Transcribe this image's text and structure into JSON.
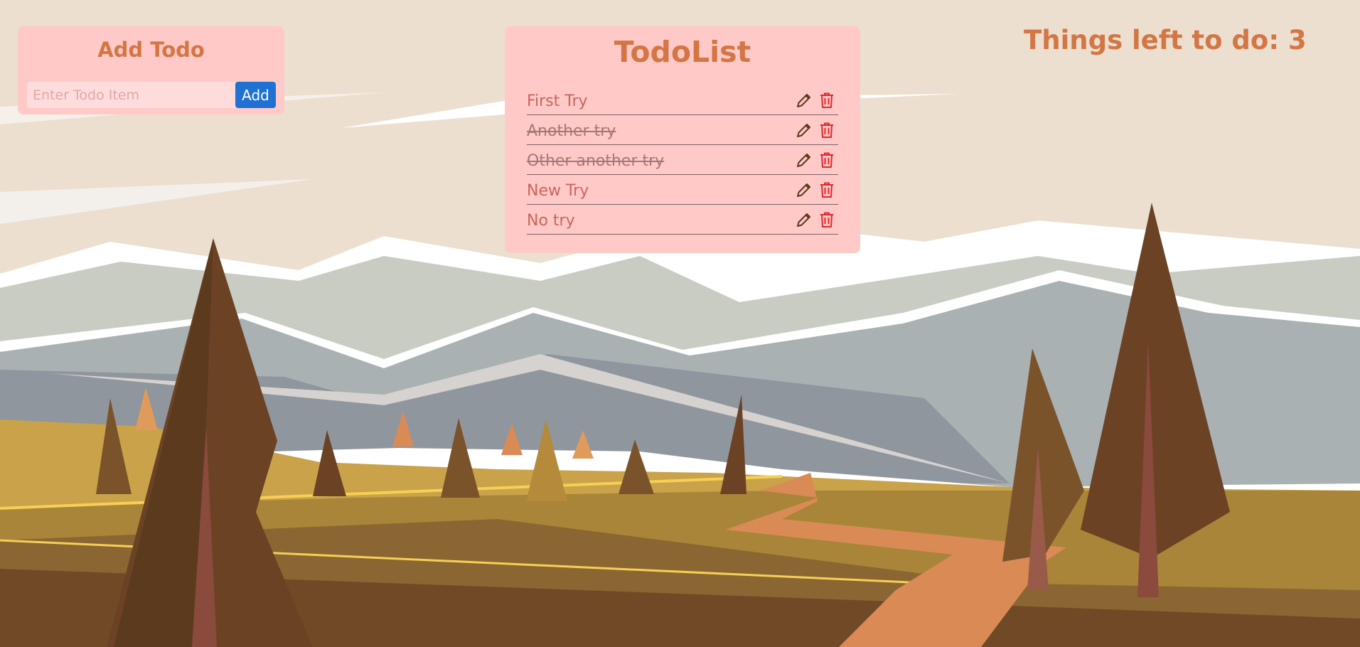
{
  "colors": {
    "sky": "#ecdfd0",
    "card": "#fec9c7",
    "heading": "#d47644",
    "add_button": "#1f71d3",
    "edit_icon": "#5b3a1b",
    "delete_icon": "#e0272c"
  },
  "add_card": {
    "title": "Add Todo",
    "input_placeholder": "Enter Todo Item",
    "input_value": "",
    "add_label": "Add"
  },
  "list_card": {
    "title": "TodoList",
    "items": [
      {
        "text": "First Try",
        "done": false
      },
      {
        "text": "Another try",
        "done": true
      },
      {
        "text": "Other another try",
        "done": true
      },
      {
        "text": "New Try",
        "done": false
      },
      {
        "text": "No try",
        "done": false
      }
    ],
    "edit_icon": "pencil-icon",
    "delete_icon": "trash-icon"
  },
  "status": {
    "left_text": "Things left to do: 3"
  }
}
